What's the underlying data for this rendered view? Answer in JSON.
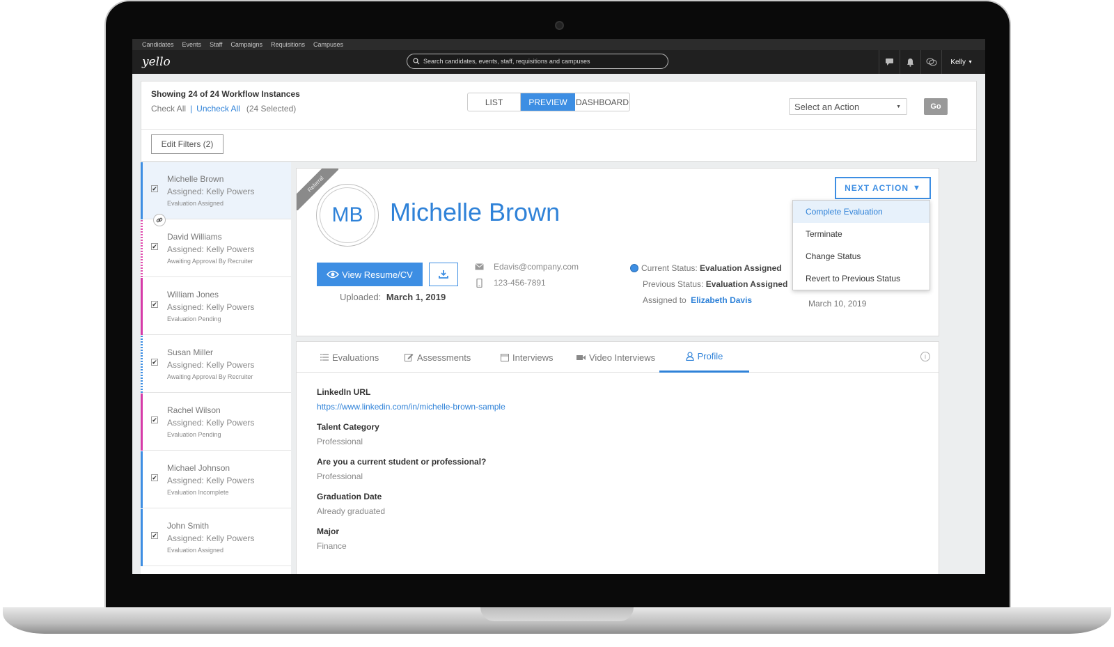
{
  "topnav": [
    "Candidates",
    "Events",
    "Staff",
    "Campaigns",
    "Requisitions",
    "Campuses"
  ],
  "header": {
    "logo": "yello",
    "search_placeholder": "Search candidates, events, staff, requisitions and campuses",
    "user": "Kelly"
  },
  "toolbar": {
    "showing": "Showing 24 of 24 Workflow Instances",
    "check_all": "Check All",
    "sep": "|",
    "uncheck_all": "Uncheck All",
    "selected": "(24 Selected)",
    "views": [
      "LIST",
      "PREVIEW",
      "DASHBOARD"
    ],
    "active_view": "PREVIEW",
    "action_select": "Select an Action",
    "go": "Go",
    "edit_filters": "Edit Filters (2)"
  },
  "candidates": [
    {
      "name": "Michelle Brown",
      "assigned": "Assigned: Kelly Powers",
      "status": "Evaluation Assigned",
      "color": "#3d8ee3"
    },
    {
      "name": "David Williams",
      "assigned": "Assigned: Kelly Powers",
      "status": "Awaiting Approval By Recruiter",
      "color": "#e14fb0"
    },
    {
      "name": "William Jones",
      "assigned": "Assigned: Kelly Powers",
      "status": "Evaluation Pending",
      "color": "#d63aa8"
    },
    {
      "name": "Susan Miller",
      "assigned": "Assigned: Kelly Powers",
      "status": "Awaiting Approval By Recruiter",
      "color": "#3d8ee3"
    },
    {
      "name": "Rachel Wilson",
      "assigned": "Assigned: Kelly Powers",
      "status": "Evaluation Pending",
      "color": "#d63aa8"
    },
    {
      "name": "Michael Johnson",
      "assigned": "Assigned: Kelly Powers",
      "status": "Evaluation Incomplete",
      "color": "#3d8ee3"
    },
    {
      "name": "John Smith",
      "assigned": "Assigned: Kelly Powers",
      "status": "Evaluation Assigned",
      "color": "#3d8ee3"
    }
  ],
  "profile": {
    "ribbon": "Referral",
    "initials": "MB",
    "name": "Michelle Brown",
    "view_resume": "View Resume/CV",
    "uploaded_label": "Uploaded:",
    "uploaded_date": "March 1, 2019",
    "email": "Edavis@company.com",
    "phone": "123-456-7891",
    "current_status_label": "Current Status:",
    "current_status": "Evaluation Assigned",
    "previous_status_label": "Previous Status:",
    "previous_status": "Evaluation Assigned",
    "assigned_label": "Assigned to",
    "assigned_to": "Elizabeth Davis",
    "next_action": "NEXT ACTION",
    "date": "March 10, 2019"
  },
  "next_action_menu": [
    "Complete Evaluation",
    "Terminate",
    "Change Status",
    "Revert to Previous Status"
  ],
  "tabs": [
    "Evaluations",
    "Assessments",
    "Interviews",
    "Video Interviews",
    "Profile"
  ],
  "active_tab": "Profile",
  "fields": [
    {
      "label": "LinkedIn URL",
      "value": "https://www.linkedin.com/in/michelle-brown-sample"
    },
    {
      "label": "Talent Category",
      "value": "Professional"
    },
    {
      "label": "Are you a current student or professional?",
      "value": "Professional"
    },
    {
      "label": "Graduation Date",
      "value": "Already graduated"
    },
    {
      "label": "Major",
      "value": "Finance"
    }
  ]
}
